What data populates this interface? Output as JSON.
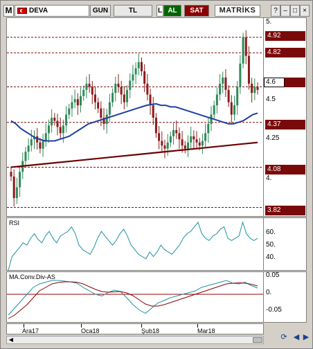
{
  "toolbar": {
    "logo": "M",
    "symbol": "DEVA",
    "period": "GUN",
    "currency": "TL",
    "partial": "L",
    "buy_label": "AL",
    "sell_label": "SAT",
    "brand": "MATRİKS",
    "help": "?",
    "minimize": "–",
    "maximize": "□",
    "close": "×"
  },
  "price_axis": {
    "ticks": [
      "5.",
      "4.5",
      "4.25",
      "4."
    ],
    "tags": [
      "4.92",
      "4.82",
      "4.37",
      "4.08",
      "3.82"
    ],
    "current": "4.6"
  },
  "rsi": {
    "label": "RSI",
    "ticks": [
      "60.",
      "50.",
      "40."
    ]
  },
  "macd": {
    "label": "MA.Conv.Div-AS",
    "ticks": [
      "0.05",
      "0.",
      "-0.05"
    ]
  },
  "x_axis": {
    "labels": [
      "Ara17",
      "Oca18",
      "Şub18",
      "Mar18"
    ]
  },
  "colors": {
    "bull": "#2e8b57",
    "bear": "#8b1a1a",
    "ma_short": "#1c3fa0",
    "ma_long": "#6b0000",
    "rsi": "#1e90a0",
    "macd": "#1e90a0",
    "signal": "#8b0000",
    "tag": "#7a0a0a"
  },
  "chart_data": [
    {
      "type": "candlestick",
      "title": "DEVA",
      "ylim": [
        3.8,
        5.0
      ],
      "levels": [
        4.92,
        4.82,
        4.6,
        4.37,
        4.08,
        3.82
      ],
      "close": [
        4.02,
        3.88,
        3.95,
        4.05,
        4.12,
        4.18,
        4.22,
        4.26,
        4.28,
        4.24,
        4.2,
        4.25,
        4.3,
        4.35,
        4.4,
        4.38,
        4.34,
        4.3,
        4.35,
        4.42,
        4.46,
        4.5,
        4.52,
        4.48,
        4.54,
        4.58,
        4.62,
        4.6,
        4.55,
        4.5,
        4.46,
        4.4,
        4.36,
        4.42,
        4.5,
        4.56,
        4.62,
        4.6,
        4.55,
        4.5,
        4.58,
        4.64,
        4.68,
        4.72,
        4.76,
        4.7,
        4.62,
        4.55,
        4.48,
        4.4,
        4.3,
        4.25,
        4.22,
        4.2,
        4.24,
        4.28,
        4.32,
        4.3,
        4.26,
        4.22,
        4.2,
        4.24,
        4.28,
        4.26,
        4.24,
        4.22,
        4.25,
        4.3,
        4.36,
        4.42,
        4.48,
        4.55,
        4.62,
        4.66,
        4.58,
        4.5,
        4.42,
        4.48,
        4.6,
        4.75,
        4.92,
        4.8,
        4.62,
        4.56,
        4.6,
        4.58
      ],
      "ma_short": [
        4.38,
        4.36,
        4.33,
        4.31,
        4.29,
        4.27,
        4.26,
        4.25,
        4.25,
        4.25,
        4.26,
        4.27,
        4.28,
        4.3,
        4.32,
        4.34,
        4.36,
        4.37,
        4.38,
        4.39,
        4.4,
        4.41,
        4.42,
        4.43,
        4.44,
        4.45,
        4.46,
        4.47,
        4.48,
        4.485,
        4.49,
        4.48,
        4.48,
        4.47,
        4.47,
        4.46,
        4.45,
        4.44,
        4.43,
        4.42,
        4.41,
        4.4,
        4.39,
        4.38,
        4.37,
        4.36,
        4.36,
        4.37,
        4.38,
        4.4,
        4.42,
        4.43
      ],
      "ma_long": [
        4.08,
        4.09,
        4.1,
        4.11,
        4.12,
        4.13,
        4.14,
        4.15,
        4.16,
        4.17,
        4.18,
        4.19,
        4.2,
        4.21,
        4.22,
        4.23,
        4.24
      ]
    },
    {
      "type": "line",
      "title": "RSI",
      "ylim": [
        30,
        70
      ],
      "values": [
        28,
        40,
        44,
        48,
        52,
        50,
        56,
        60,
        55,
        52,
        58,
        62,
        56,
        52,
        58,
        60,
        62,
        66,
        60,
        50,
        46,
        44,
        42,
        48,
        56,
        62,
        58,
        54,
        50,
        54,
        60,
        64,
        58,
        50,
        46,
        42,
        40,
        38,
        44,
        40,
        44,
        50,
        46,
        44,
        42,
        46,
        50,
        56,
        60,
        62,
        66,
        70,
        60,
        56,
        54,
        58,
        60,
        64,
        66,
        56,
        54,
        56,
        58,
        70,
        60,
        56,
        54,
        56
      ]
    },
    {
      "type": "line",
      "title": "MA.Conv.Div-AS",
      "ylim": [
        -0.08,
        0.06
      ],
      "series": [
        {
          "values": [
            -0.06,
            -0.04,
            -0.02,
            0.0,
            0.02,
            0.03,
            0.035,
            0.04,
            0.04,
            0.038,
            0.036,
            0.032,
            0.02,
            0.01,
            0.0,
            -0.005,
            0.005,
            0.012,
            0.008,
            -0.01,
            -0.03,
            -0.045,
            -0.055,
            -0.04,
            -0.025,
            -0.018,
            -0.01,
            -0.005,
            0.0,
            0.005,
            0.01,
            0.02,
            0.025,
            0.03,
            0.035,
            0.04,
            0.032,
            0.03,
            0.035,
            0.025,
            0.018
          ]
        },
        {
          "values": [
            -0.07,
            -0.06,
            -0.045,
            -0.03,
            -0.01,
            0.01,
            0.02,
            0.03,
            0.034,
            0.036,
            0.036,
            0.035,
            0.03,
            0.022,
            0.014,
            0.008,
            0.006,
            0.007,
            0.008,
            0.004,
            -0.004,
            -0.016,
            -0.028,
            -0.034,
            -0.034,
            -0.03,
            -0.024,
            -0.018,
            -0.012,
            -0.006,
            0.0,
            0.006,
            0.012,
            0.018,
            0.024,
            0.03,
            0.032,
            0.033,
            0.032,
            0.029,
            0.024
          ]
        }
      ]
    }
  ]
}
